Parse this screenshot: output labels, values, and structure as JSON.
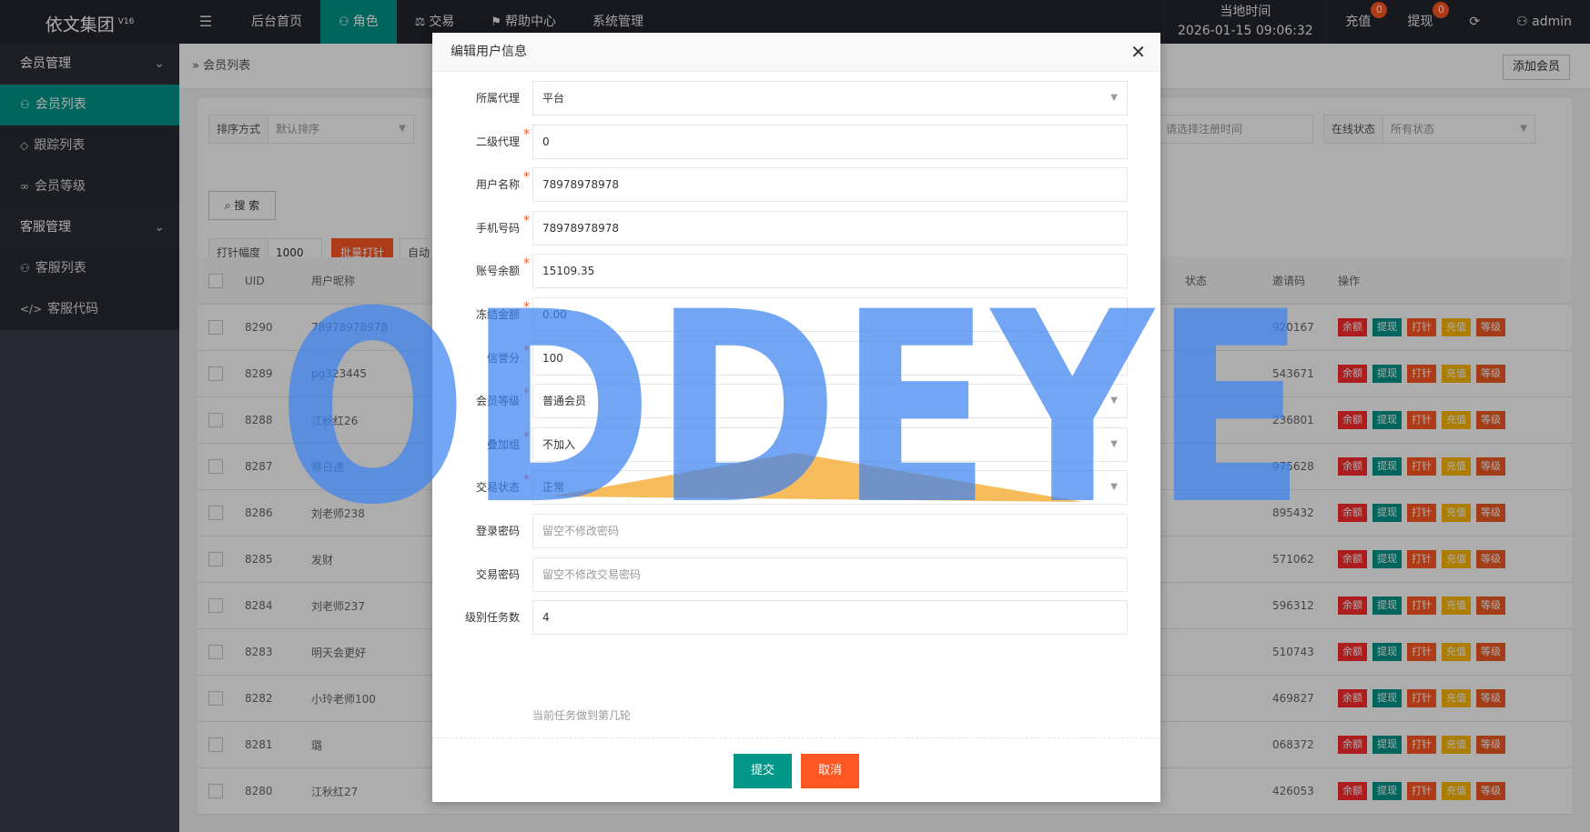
{
  "app": {
    "title": "依文集团",
    "version": "V16"
  },
  "nav": {
    "items": [
      {
        "label": "后台首页"
      },
      {
        "label": "角色"
      },
      {
        "label": "交易"
      },
      {
        "label": "帮助中心"
      },
      {
        "label": "系统管理"
      }
    ]
  },
  "header": {
    "clock_label": "当地时间",
    "clock_value": "2026-01-15 09:06:32",
    "recharge": "充值",
    "recharge_count": "0",
    "withdraw": "提现",
    "withdraw_count": "0",
    "user": "admin"
  },
  "sidebar": {
    "group1": "会员管理",
    "items1": [
      {
        "label": "会员列表"
      },
      {
        "label": "跟踪列表"
      },
      {
        "label": "会员等级"
      }
    ],
    "group2": "客服管理",
    "items2": [
      {
        "label": "客服列表"
      },
      {
        "label": "客服代码"
      }
    ]
  },
  "page": {
    "breadcrumb": "会员列表",
    "add_button": "添加会员"
  },
  "filters": {
    "sort_label": "排序方式",
    "sort_value": "默认排序",
    "date_placeholder": "请选择注册时间",
    "online_label": "在线状态",
    "online_value": "所有状态",
    "search": "搜 索",
    "pin_label": "打针幅度",
    "pin_value": "1000",
    "batch_button": "批量打针",
    "auto_label": "自动"
  },
  "table": {
    "headers": {
      "uid": "UID",
      "nick": "用户昵称",
      "status": "状态",
      "invite": "邀请码",
      "ops": "操作"
    },
    "ops": [
      "余额",
      "提现",
      "打针",
      "充值",
      "等级"
    ],
    "rows": [
      {
        "uid": "8290",
        "nick": "78978978978",
        "invite": "920167"
      },
      {
        "uid": "8289",
        "nick": "pg323445",
        "invite": "543671"
      },
      {
        "uid": "8288",
        "nick": "江秋红26",
        "invite": "236801"
      },
      {
        "uid": "8287",
        "nick": "蔡日递",
        "invite": "975628"
      },
      {
        "uid": "8286",
        "nick": "刘老师238",
        "invite": "895432"
      },
      {
        "uid": "8285",
        "nick": "发财",
        "invite": "571062"
      },
      {
        "uid": "8284",
        "nick": "刘老师237",
        "invite": "596312"
      },
      {
        "uid": "8283",
        "nick": "明天会更好",
        "invite": "510743"
      },
      {
        "uid": "8282",
        "nick": "小玲老师100",
        "invite": "469827"
      },
      {
        "uid": "8281",
        "nick": "璐",
        "invite": "068372"
      },
      {
        "uid": "8280",
        "nick": "江秋红27",
        "invite": "426053"
      }
    ]
  },
  "modal": {
    "title": "编辑用户信息",
    "fields": [
      {
        "label": "所属代理",
        "value": "平台",
        "required": false,
        "select": true
      },
      {
        "label": "二级代理",
        "value": "0",
        "required": true,
        "select": false
      },
      {
        "label": "用户名称",
        "value": "78978978978",
        "required": true,
        "select": false
      },
      {
        "label": "手机号码",
        "value": "78978978978",
        "required": true,
        "select": false
      },
      {
        "label": "账号余额",
        "value": "15109.35",
        "required": true,
        "select": false
      },
      {
        "label": "冻结金额",
        "value": "0.00",
        "required": true,
        "select": false
      },
      {
        "label": "信誉分",
        "value": "100",
        "required": true,
        "select": false
      },
      {
        "label": "会员等级",
        "value": "普通会员",
        "required": true,
        "select": true
      },
      {
        "label": "叠加组",
        "value": "不加入",
        "required": true,
        "select": true
      },
      {
        "label": "交易状态",
        "value": "正常",
        "required": true,
        "select": true
      },
      {
        "label": "登录密码",
        "placeholder": "留空不修改密码",
        "required": false,
        "select": false
      },
      {
        "label": "交易密码",
        "placeholder": "留空不修改交易密码",
        "required": false,
        "select": false
      },
      {
        "label": "级别任务数",
        "value": "4",
        "required": false,
        "select": false
      }
    ],
    "hint": "当前任务做到第几轮",
    "submit": "提交",
    "cancel": "取消"
  },
  "watermark": {
    "text": "ODDEYE"
  },
  "colors": {
    "topbar": "#23262e",
    "sidebar": "#393d49",
    "accent": "#009688",
    "danger": "#ff5722",
    "warning": "#ffb800",
    "watermark": "#3c82f0"
  }
}
